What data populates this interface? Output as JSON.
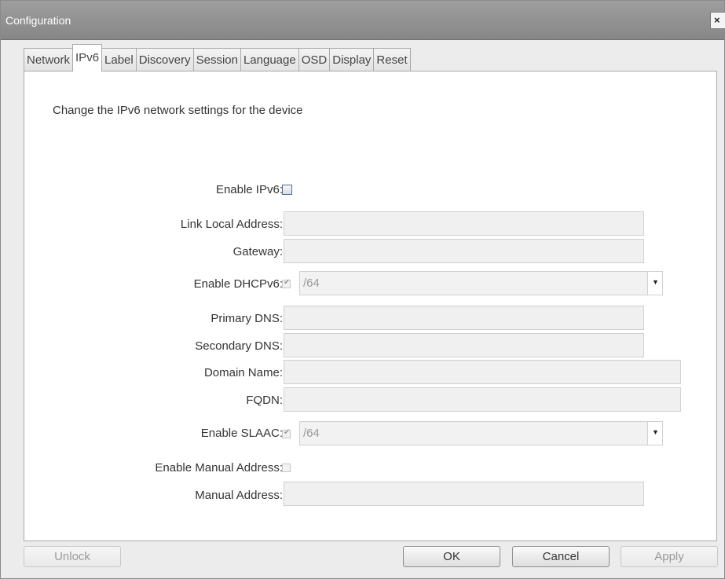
{
  "window": {
    "title": "Configuration",
    "close_glyph": "×"
  },
  "tabs": [
    {
      "label": "Network",
      "active": false
    },
    {
      "label": "IPv6",
      "active": true
    },
    {
      "label": "Label",
      "active": false
    },
    {
      "label": "Discovery",
      "active": false
    },
    {
      "label": "Session",
      "active": false
    },
    {
      "label": "Language",
      "active": false
    },
    {
      "label": "OSD",
      "active": false
    },
    {
      "label": "Display",
      "active": false
    },
    {
      "label": "Reset",
      "active": false
    }
  ],
  "panel": {
    "description": "Change the IPv6 network settings for the device",
    "enable_ipv6": {
      "label": "Enable IPv6:",
      "checked": false
    },
    "link_local": {
      "label": "Link Local Address:",
      "value": ""
    },
    "gateway": {
      "label": "Gateway:",
      "value": ""
    },
    "enable_dhcpv6": {
      "label": "Enable DHCPv6:",
      "checked": true,
      "prefix": "/64"
    },
    "primary_dns": {
      "label": "Primary DNS:",
      "value": ""
    },
    "secondary_dns": {
      "label": "Secondary DNS:",
      "value": ""
    },
    "domain_name": {
      "label": "Domain Name:",
      "value": ""
    },
    "fqdn": {
      "label": "FQDN:",
      "value": ""
    },
    "enable_slaac": {
      "label": "Enable SLAAC:",
      "checked": true,
      "prefix": "/64"
    },
    "enable_manual": {
      "label": "Enable Manual Address:",
      "checked": false
    },
    "manual_address": {
      "label": "Manual Address:",
      "value": ""
    }
  },
  "buttons": {
    "unlock": "Unlock",
    "ok": "OK",
    "cancel": "Cancel",
    "apply": "Apply"
  },
  "icons": {
    "checkmark": "✔",
    "dropdown_arrow": "▼"
  }
}
